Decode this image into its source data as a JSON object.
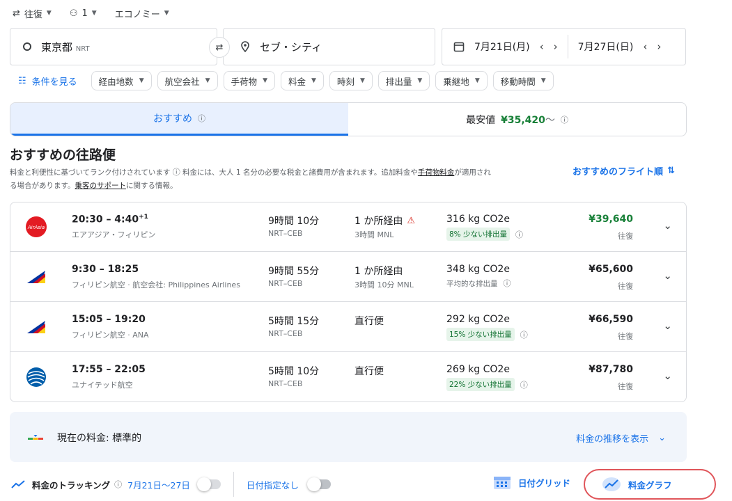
{
  "top_options": {
    "trip_type": "往復",
    "passengers": "1",
    "cabin": "エコノミー"
  },
  "search": {
    "origin": "東京都",
    "origin_code": "NRT",
    "destination": "セブ・シティ",
    "depart_date": "7月21日(月)",
    "return_date": "7月27日(日)"
  },
  "filters": {
    "conditions_label": "条件を見る",
    "chips": [
      "経由地数",
      "航空会社",
      "手荷物",
      "料金",
      "時刻",
      "排出量",
      "乗継地",
      "移動時間"
    ]
  },
  "tabs": {
    "recommended": "おすすめ",
    "cheapest_label": "最安値",
    "cheapest_price": "¥35,420",
    "cheapest_suffix": "〜"
  },
  "results": {
    "heading": "おすすめの往路便",
    "desc_1": "料金と利便性に基づいてランク付けされています",
    "desc_2": "料金には、大人 1 名分の必要な税金と諸費用が含まれます。追加料金や",
    "desc_link_1": "手荷物料金",
    "desc_3": "が適用され",
    "desc_4": "る場合があります。",
    "desc_link_2": "乗客のサポート",
    "desc_5": "に関する情報。",
    "sort_label": "おすすめのフライト順"
  },
  "flights": [
    {
      "time": "20:30 – 4:40",
      "day_offset": "+1",
      "airline": "エアアジア・フィリピン",
      "duration": "9時間 10分",
      "route": "NRT–CEB",
      "stops": "1 か所経由",
      "stop_detail": "3時間 MNL",
      "warning": true,
      "co2": "316 kg CO2e",
      "emission": "8% 少ない排出量",
      "emission_badge": true,
      "price": "¥39,640",
      "price_green": true,
      "trip": "往復",
      "logo": "airasia"
    },
    {
      "time": "9:30 – 18:25",
      "day_offset": "",
      "airline": "フィリピン航空 · 航空会社: Philippines Airlines",
      "duration": "9時間 55分",
      "route": "NRT–CEB",
      "stops": "1 か所経由",
      "stop_detail": "3時間 10分 MNL",
      "warning": false,
      "co2": "348 kg CO2e",
      "emission": "平均的な排出量",
      "emission_badge": false,
      "price": "¥65,600",
      "price_green": false,
      "trip": "往復",
      "logo": "pal"
    },
    {
      "time": "15:05 – 19:20",
      "day_offset": "",
      "airline": "フィリピン航空 · ANA",
      "duration": "5時間 15分",
      "route": "NRT–CEB",
      "stops": "直行便",
      "stop_detail": "",
      "warning": false,
      "co2": "292 kg CO2e",
      "emission": "15% 少ない排出量",
      "emission_badge": true,
      "price": "¥66,590",
      "price_green": false,
      "trip": "往復",
      "logo": "pal"
    },
    {
      "time": "17:55 – 22:05",
      "day_offset": "",
      "airline": "ユナイテッド航空",
      "duration": "5時間 10分",
      "route": "NRT–CEB",
      "stops": "直行便",
      "stop_detail": "",
      "warning": false,
      "co2": "269 kg CO2e",
      "emission": "22% 少ない排出量",
      "emission_badge": true,
      "price": "¥87,780",
      "price_green": false,
      "trip": "往復",
      "logo": "united"
    }
  ],
  "insight": {
    "text": "現在の料金: 標準的",
    "link": "料金の推移を表示"
  },
  "bottom": {
    "tracking_label": "料金のトラッキング",
    "tracking_dates": "7月21日〜27日",
    "no_date_label": "日付指定なし",
    "date_grid": "日付グリッド",
    "price_graph": "料金グラフ"
  },
  "colors": {
    "accent": "#1a73e8",
    "green": "#188038",
    "highlight": "#e0555a"
  }
}
